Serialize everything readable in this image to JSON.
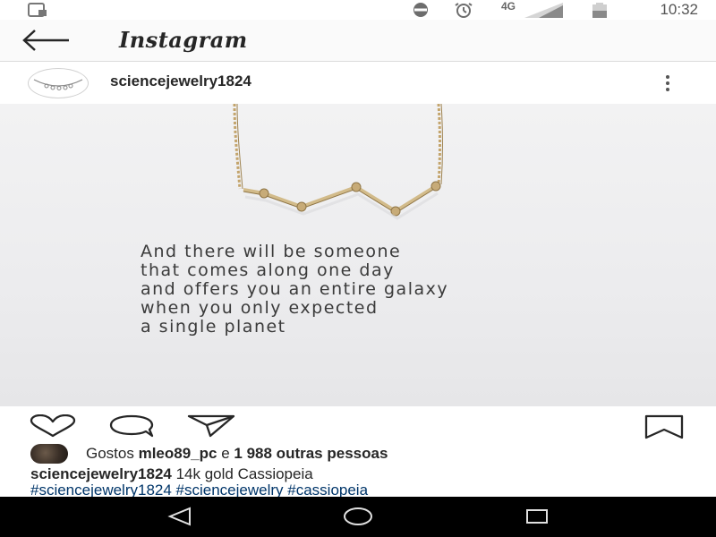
{
  "status_bar": {
    "network": "4G",
    "time": "10:32"
  },
  "app_bar": {
    "title": "Instagram"
  },
  "post": {
    "username": "sciencejewelry1824",
    "quote_lines": [
      "And there will be someone",
      "that comes along one day",
      "and offers you an entire galaxy",
      "when you only expected",
      "a single planet"
    ]
  },
  "likes": {
    "prefix": "Gostos",
    "user": "mleo89_pc",
    "connector": "e",
    "others": "1 988 outras pessoas"
  },
  "caption": {
    "username": "sciencejewelry1824",
    "text": "14k gold Cassiopeia"
  },
  "hashtags": {
    "text": "#sciencejewelry1824 #sciencejewelry #cassiopeia"
  },
  "icons": {
    "status": [
      "screenshot-icon",
      "do-not-disturb-icon",
      "alarm-icon",
      "signal-icon",
      "battery-icon"
    ],
    "actions": [
      "heart-icon",
      "comment-icon",
      "share-icon",
      "bookmark-icon"
    ],
    "nav": [
      "back-nav-icon",
      "home-nav-icon",
      "recents-nav-icon"
    ]
  },
  "colors": {
    "hashtag": "#003569",
    "text": "#262626",
    "navbar": "#000000"
  }
}
